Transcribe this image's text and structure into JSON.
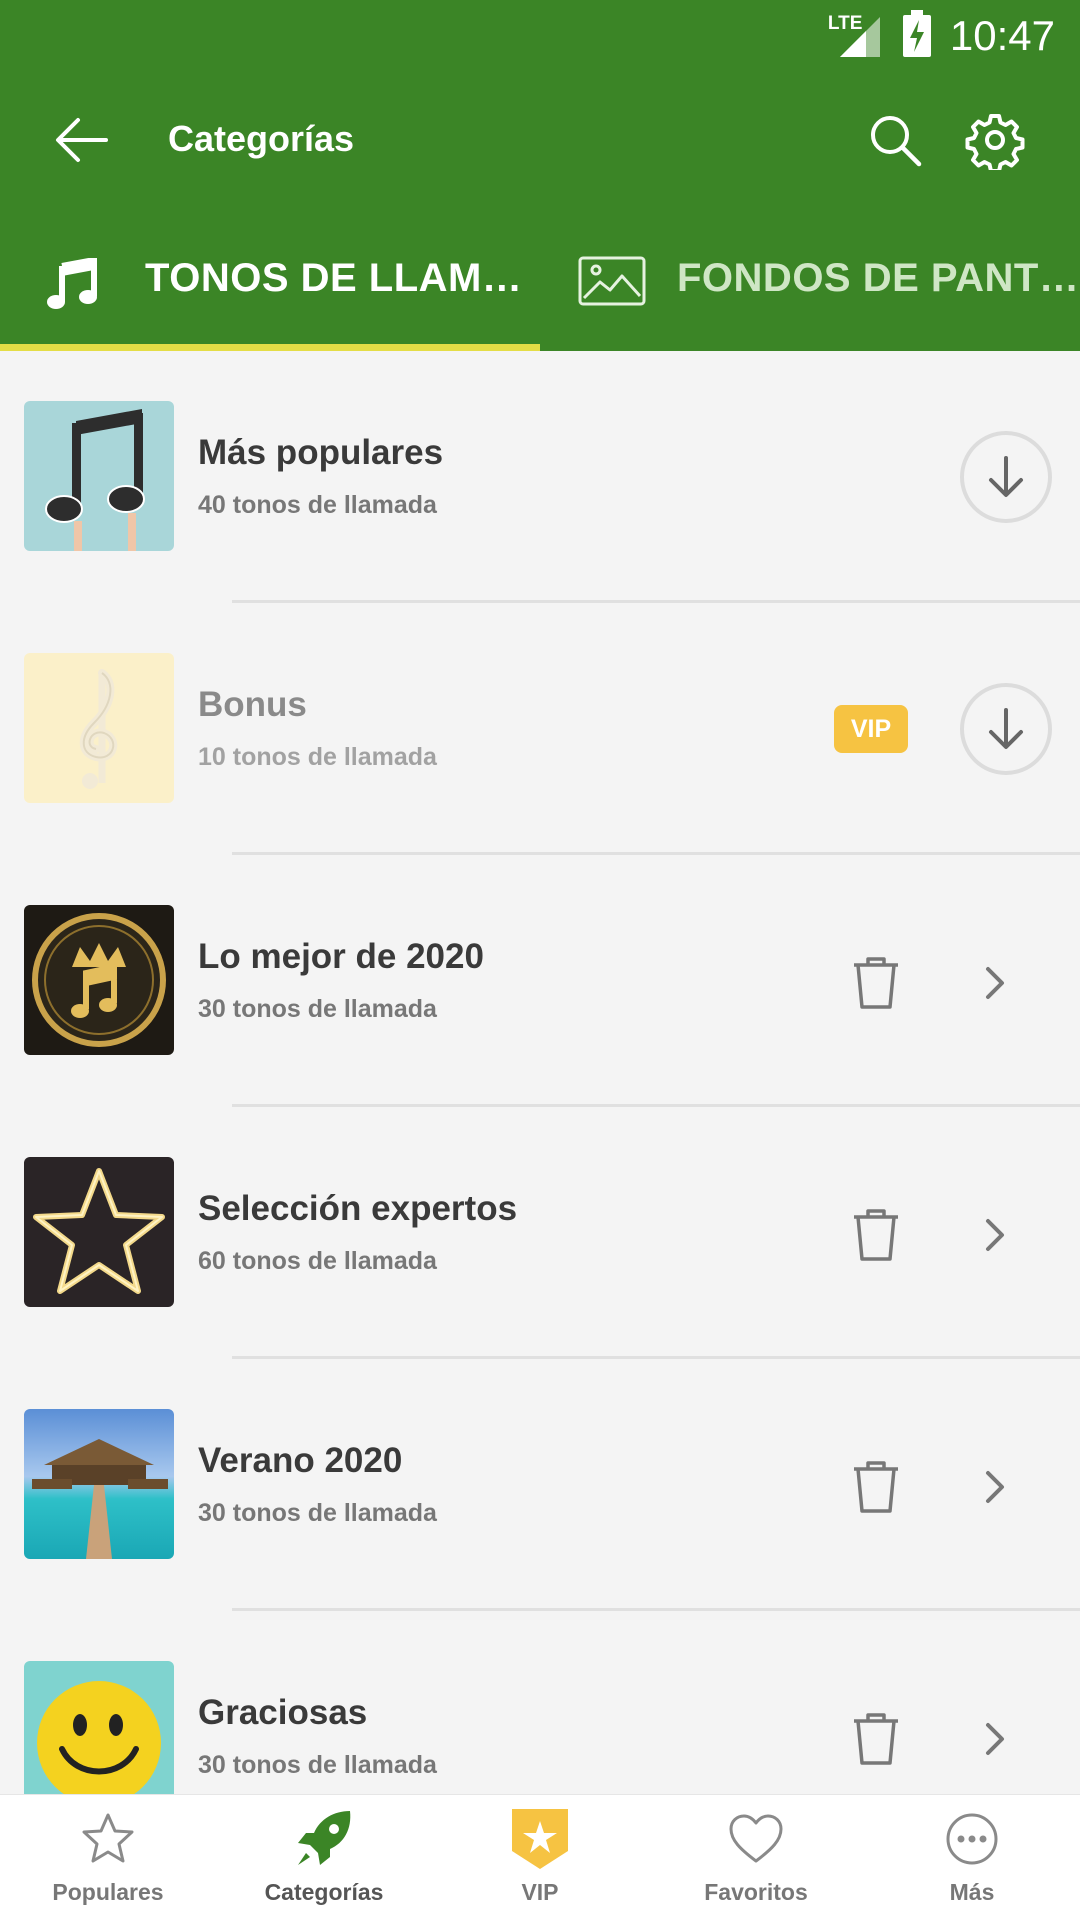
{
  "status_bar": {
    "network": "LTE",
    "time": "10:47"
  },
  "toolbar": {
    "title": "Categorías"
  },
  "tabs": [
    {
      "label": "TONOS DE LLAM…",
      "icon": "music-note-icon",
      "selected": true
    },
    {
      "label": "FONDOS DE PANT…",
      "icon": "image-icon",
      "selected": false
    }
  ],
  "categories": [
    {
      "title": "Más populares",
      "subtitle": "40 tonos de llamada",
      "action": "download",
      "vip": false
    },
    {
      "title": "Bonus",
      "subtitle": "10 tonos de llamada",
      "action": "download",
      "vip": true,
      "vip_label": "VIP"
    },
    {
      "title": "Lo mejor de 2020",
      "subtitle": "30 tonos de llamada",
      "action": "open"
    },
    {
      "title": "Selección expertos",
      "subtitle": "60 tonos de llamada",
      "action": "open"
    },
    {
      "title": "Verano 2020",
      "subtitle": "30 tonos de llamada",
      "action": "open"
    },
    {
      "title": "Graciosas",
      "subtitle": "30 tonos de llamada",
      "action": "open"
    }
  ],
  "bottom_nav": [
    {
      "label": "Populares",
      "icon": "star-icon"
    },
    {
      "label": "Categorías",
      "icon": "rocket-icon",
      "active": true
    },
    {
      "label": "VIP",
      "icon": "vip-shield-icon"
    },
    {
      "label": "Favoritos",
      "icon": "heart-icon"
    },
    {
      "label": "Más",
      "icon": "more-icon"
    }
  ],
  "colors": {
    "primary": "#3b8526",
    "indicator": "#e4dd46",
    "vip": "#f6c342",
    "background": "#f4f4f4"
  }
}
